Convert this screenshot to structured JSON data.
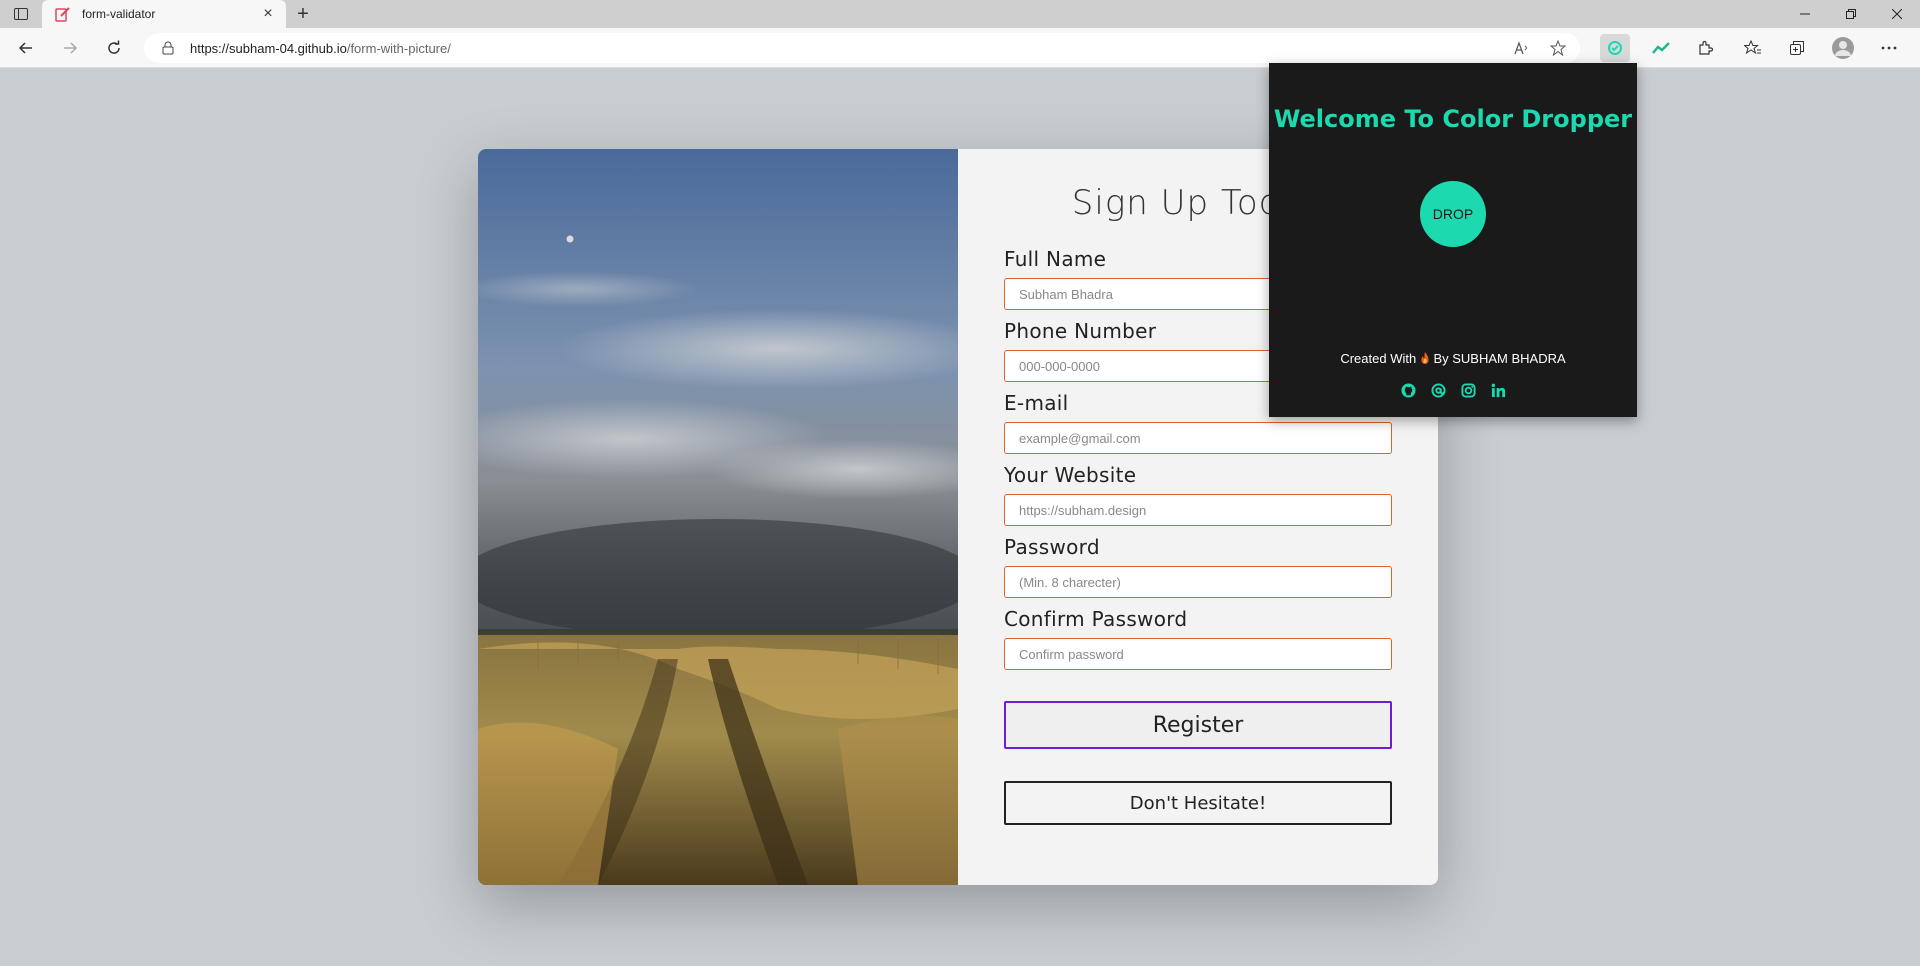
{
  "browser": {
    "tab_title": "form-validator",
    "new_tab_glyph": "+",
    "close_glyph": "×",
    "url_host": "https://subham-04.github.io",
    "url_path": "/form-with-picture/",
    "icons": [
      "tab-actions-icon",
      "back-icon",
      "forward-icon",
      "reload-icon",
      "lock-icon",
      "read-aloud-icon",
      "add-favorite-icon",
      "color-dropper-extension-icon",
      "stats-extension-icon",
      "extensions-icon",
      "favorites-icon",
      "collections-icon",
      "profile-icon",
      "more-icon"
    ],
    "accent": "#1cd9b0"
  },
  "form": {
    "title": "Sign Up Today",
    "fields": [
      {
        "label": "Full Name",
        "placeholder": "Subham Bhadra"
      },
      {
        "label": "Phone Number",
        "placeholder": "000-000-0000"
      },
      {
        "label": "E-mail",
        "placeholder": "example@gmail.com"
      },
      {
        "label": "Your Website",
        "placeholder": "https://subham.design"
      },
      {
        "label": "Password",
        "placeholder": "(Min. 8 charecter)"
      },
      {
        "label": "Confirm Password",
        "placeholder": "Confirm password"
      }
    ],
    "register_label": "Register",
    "hesitate_label": "Don't Hesitate!",
    "input_border_color": "#e0632c",
    "register_border_color": "#6a1fd6"
  },
  "popup": {
    "title": "Welcome To Color Dropper",
    "drop_label": "DROP",
    "credits_prefix": "Created With",
    "credits_suffix": "By SUBHAM BHADRA",
    "social_icons": [
      "github-icon",
      "at-sign-icon",
      "instagram-icon",
      "linkedin-icon"
    ],
    "accent": "#1cd9b0",
    "background": "#1a1a1a"
  }
}
